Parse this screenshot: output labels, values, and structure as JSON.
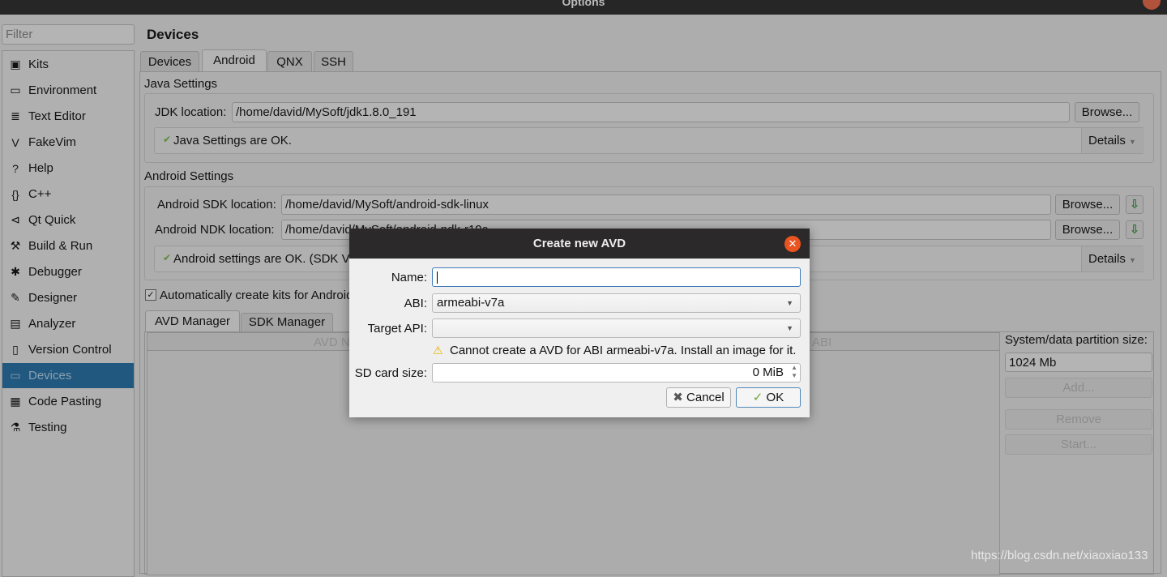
{
  "window": {
    "title": "Options"
  },
  "sidebar": {
    "filter_placeholder": "Filter",
    "items": [
      {
        "label": "Kits",
        "icon": "kits-icon",
        "glyph": "▣"
      },
      {
        "label": "Environment",
        "icon": "monitor-icon",
        "glyph": "▭"
      },
      {
        "label": "Text Editor",
        "icon": "text-editor-icon",
        "glyph": "≣"
      },
      {
        "label": "FakeVim",
        "icon": "fakevim-icon",
        "glyph": "V"
      },
      {
        "label": "Help",
        "icon": "help-icon",
        "glyph": "?"
      },
      {
        "label": "C++",
        "icon": "braces-icon",
        "glyph": "{}"
      },
      {
        "label": "Qt Quick",
        "icon": "qt-quick-icon",
        "glyph": "⊲"
      },
      {
        "label": "Build & Run",
        "icon": "hammer-icon",
        "glyph": "⚒"
      },
      {
        "label": "Debugger",
        "icon": "bug-icon",
        "glyph": "✱"
      },
      {
        "label": "Designer",
        "icon": "pencil-icon",
        "glyph": "✎"
      },
      {
        "label": "Analyzer",
        "icon": "analyzer-icon",
        "glyph": "▤"
      },
      {
        "label": "Version Control",
        "icon": "version-control-icon",
        "glyph": "▯"
      },
      {
        "label": "Devices",
        "icon": "devices-icon",
        "glyph": "▭",
        "selected": true
      },
      {
        "label": "Code Pasting",
        "icon": "clipboard-icon",
        "glyph": "▦"
      },
      {
        "label": "Testing",
        "icon": "flask-icon",
        "glyph": "⚗"
      }
    ]
  },
  "page": {
    "title": "Devices",
    "tabs": [
      "Devices",
      "Android",
      "QNX",
      "SSH"
    ],
    "active_tab": "Android"
  },
  "java": {
    "title": "Java Settings",
    "jdk_label": "JDK location:",
    "jdk_value": "/home/david/MySoft/jdk1.8.0_191",
    "browse": "Browse...",
    "status": "Java Settings are OK.",
    "details": "Details"
  },
  "android": {
    "title": "Android Settings",
    "sdk_label": "Android SDK location:",
    "sdk_value": "/home/david/MySoft/android-sdk-linux",
    "ndk_label": "Android NDK location:",
    "ndk_value": "/home/david/MySoft/android-ndk-r19c",
    "browse": "Browse...",
    "status": "Android settings are OK. (SDK V",
    "details": "Details",
    "auto_kits": "Automatically create kits for Android tool chains",
    "auto_kits_checked": true
  },
  "manager": {
    "tabs": [
      "AVD Manager",
      "SDK Manager"
    ],
    "active_tab": "AVD Manager",
    "columns": [
      "AVD Name",
      "ABI"
    ],
    "partition_label": "System/data partition size:",
    "partition_value": "1024 Mb",
    "add": "Add...",
    "remove": "Remove",
    "start": "Start..."
  },
  "dialog": {
    "title": "Create new AVD",
    "name_label": "Name:",
    "name_value": "",
    "abi_label": "ABI:",
    "abi_value": "armeabi-v7a",
    "api_label": "Target API:",
    "api_value": "",
    "warning": "Cannot create a AVD for ABI armeabi-v7a. Install an image for it.",
    "sd_label": "SD card size:",
    "sd_value": "0 MiB",
    "cancel": "Cancel",
    "ok": "OK"
  },
  "watermark": "https://blog.csdn.net/xiaoxiao133",
  "colors": {
    "selection": "#21587f",
    "dialog_close": "#e95420",
    "ok_check": "#6aa82e",
    "warning": "#f0c000"
  }
}
